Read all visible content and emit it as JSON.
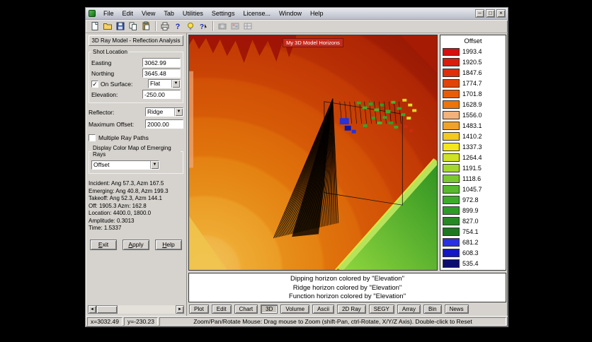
{
  "window": {
    "controls": {
      "minimize": "–",
      "maximize": "□",
      "close": "×"
    }
  },
  "menu": {
    "items": [
      "File",
      "Edit",
      "View",
      "Tab",
      "Utilities",
      "Settings",
      "License...",
      "Window",
      "Help"
    ]
  },
  "toolbar": {
    "groups": [
      [
        "new-document",
        "open-folder",
        "save",
        "copy",
        "paste"
      ],
      [
        "print",
        "help",
        "tip",
        "context-help"
      ],
      [
        "snapshot",
        "palette",
        "grid"
      ]
    ]
  },
  "left_panel": {
    "tab_title": "3D Ray Model - Reflection Analysis",
    "shot_location": {
      "group_label": "Shot Location",
      "easting_label": "Easting",
      "easting_value": "3062.99",
      "northing_label": "Northing",
      "northing_value": "3645.48",
      "on_surface_label": "On Surface:",
      "on_surface_checked": true,
      "on_surface_value": "Flat",
      "elevation_label": "Elevation:",
      "elevation_value": "-250.00"
    },
    "reflector_label": "Reflector:",
    "reflector_value": "Ridge",
    "max_offset_label": "Maximum Offset:",
    "max_offset_value": "2000.00",
    "multiple_ray_paths_label": "Multiple Ray Paths",
    "multiple_ray_paths_checked": false,
    "color_map_group_label": "Display Color Map of Emerging Rays",
    "color_map_value": "Offset",
    "info_lines": [
      "Incident:  Ang  57.3, Azm 167.5",
      "Emerging: Ang  40.8, Azm 199.3",
      "Takeoff:  Ang  52.3, Azm 144.1",
      "Off:       1905.3 Azm: 162.8",
      "Location:    4400.0,      1800.0",
      "Amplitude:   0.3013",
      "Time:      1.5337"
    ],
    "buttons": {
      "exit": "Exit",
      "apply": "Apply",
      "help": "Help"
    }
  },
  "viewport": {
    "label": "My 3D Model Horizons"
  },
  "legend": {
    "title": "Offset",
    "entries": [
      {
        "value": "1993.4",
        "color": "#d80f0f"
      },
      {
        "value": "1920.5",
        "color": "#da1c0c"
      },
      {
        "value": "1847.6",
        "color": "#de2e0a"
      },
      {
        "value": "1774.7",
        "color": "#e24408"
      },
      {
        "value": "1701.8",
        "color": "#e75c07"
      },
      {
        "value": "1628.9",
        "color": "#ec7408"
      },
      {
        "value": "1556.0",
        "color": "#f2b27a"
      },
      {
        "value": "1483.1",
        "color": "#f0a228"
      },
      {
        "value": "1410.2",
        "color": "#f4c81e"
      },
      {
        "value": "1337.3",
        "color": "#f4e61c"
      },
      {
        "value": "1264.4",
        "color": "#cfe226"
      },
      {
        "value": "1191.5",
        "color": "#a4d72c"
      },
      {
        "value": "1118.6",
        "color": "#7ac830"
      },
      {
        "value": "1045.7",
        "color": "#57ba2e"
      },
      {
        "value": "972.8",
        "color": "#3cab2a"
      },
      {
        "value": "899.9",
        "color": "#2e9b28"
      },
      {
        "value": "827.0",
        "color": "#268924"
      },
      {
        "value": "754.1",
        "color": "#1e7820"
      },
      {
        "value": "681.2",
        "color": "#2b2fe2"
      },
      {
        "value": "608.3",
        "color": "#1317c4"
      },
      {
        "value": "535.4",
        "color": "#0c0c70"
      }
    ]
  },
  "caption": {
    "lines": [
      "Dipping horizon colored by \"Elevation\"",
      "Ridge horizon colored by \"Elevation\"",
      "Function horizon colored by \"Elevation\""
    ]
  },
  "bottom_tabs": {
    "items": [
      "Plot",
      "Edit",
      "Chart",
      "3D",
      "Volume",
      "Ascii",
      "2D Ray",
      "SEGY",
      "Array",
      "Bin",
      "News"
    ],
    "active": "3D"
  },
  "status_bar": {
    "x": "x=3032.49",
    "y": "y=-230.23",
    "message": "Zoom/Pan/Rotate Mouse: Drag mouse to Zoom (shift-Pan, ctrl-Rotate, X/Y/Z Axis). Double-click to Reset"
  }
}
